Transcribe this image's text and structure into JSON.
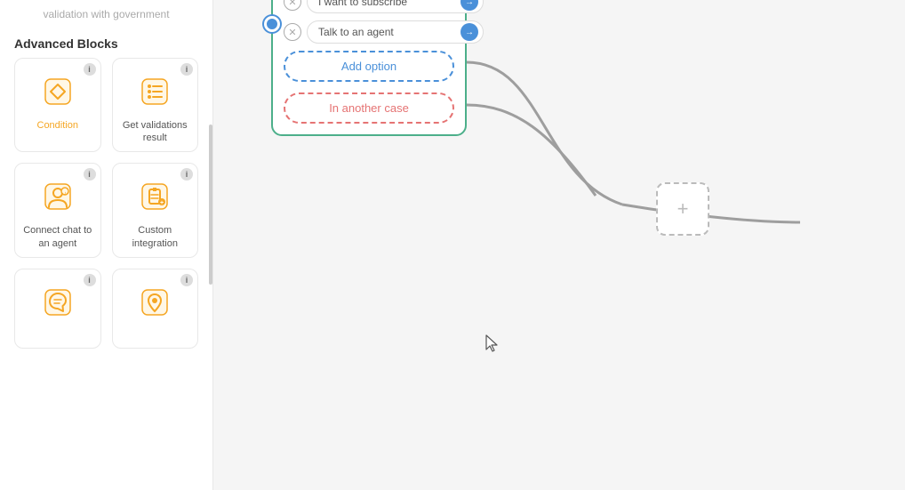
{
  "sidebar": {
    "top_text": "validation with government",
    "advanced_blocks_label": "Advanced Blocks",
    "blocks": [
      {
        "id": "condition",
        "label": "Condition",
        "label_active": true,
        "icon_type": "condition",
        "has_info": true
      },
      {
        "id": "get-validations",
        "label": "Get validations result",
        "label_active": false,
        "icon_type": "list",
        "has_info": true
      },
      {
        "id": "connect-chat",
        "label": "Connect chat to an agent",
        "label_active": false,
        "icon_type": "agent",
        "has_info": true
      },
      {
        "id": "custom-integration",
        "label": "Custom integration",
        "label_active": false,
        "icon_type": "integration",
        "has_info": true
      },
      {
        "id": "block5",
        "label": "",
        "label_active": false,
        "icon_type": "openai",
        "has_info": true
      },
      {
        "id": "block6",
        "label": "",
        "label_active": false,
        "icon_type": "location",
        "has_info": true
      }
    ]
  },
  "flow": {
    "options": [
      {
        "text": "I want to subscribe"
      },
      {
        "text": "Talk to an agent"
      }
    ],
    "add_option_label": "Add option",
    "in_another_case_label": "In another case"
  },
  "plus_node_label": "+",
  "info_icon_char": "i",
  "close_icon_char": "✕",
  "arrow_icon_char": "→"
}
